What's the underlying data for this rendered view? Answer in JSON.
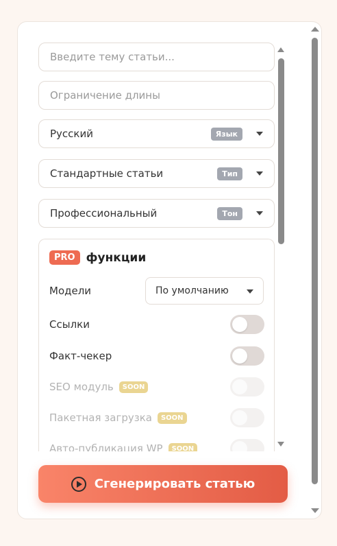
{
  "form": {
    "topic_placeholder": "Введите тему статьи...",
    "length_placeholder": "Ограничение длины",
    "language": {
      "value": "Русский",
      "badge": "Язык"
    },
    "type": {
      "value": "Стандартные статьи",
      "badge": "Тип"
    },
    "tone": {
      "value": "Профессиональный",
      "badge": "Тон"
    }
  },
  "pro": {
    "badge": "PRO",
    "title": "функции",
    "models_label": "Модели",
    "models_value": "По умолчанию",
    "features": [
      {
        "label": "Ссылки",
        "enabled": false
      },
      {
        "label": "Факт-чекер",
        "enabled": false
      },
      {
        "label": "SEO модуль",
        "soon": "SOON"
      },
      {
        "label": "Пакетная загрузка",
        "soon": "SOON"
      },
      {
        "label": "Авто-публикация WP",
        "soon": "SOON"
      }
    ]
  },
  "generate_label": "Сгенерировать статью",
  "colors": {
    "accent": "#ee6b52",
    "soon": "#ead592",
    "badge": "#a3a7b0"
  }
}
